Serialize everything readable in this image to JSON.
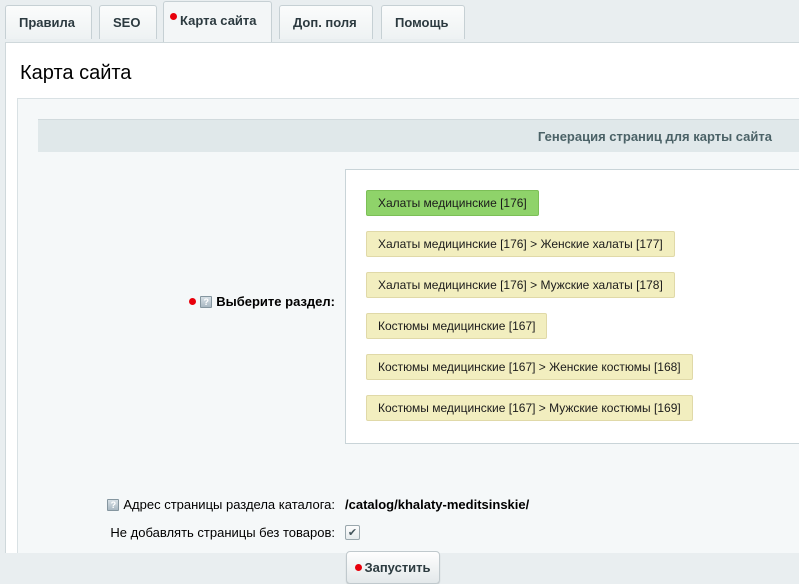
{
  "tabs": [
    {
      "label": "Правила",
      "active": false
    },
    {
      "label": "SEO",
      "active": false
    },
    {
      "label": "Карта сайта",
      "active": true
    },
    {
      "label": "Доп. поля",
      "active": false
    },
    {
      "label": "Помощь",
      "active": false
    }
  ],
  "page_title": "Карта сайта",
  "section_header": "Генерация страниц для карты сайта",
  "section_select": {
    "label": "Выберите раздел:",
    "required": true,
    "items": [
      {
        "label": "Халаты медицинские [176]",
        "selected": true
      },
      {
        "label": "Халаты медицинские [176] > Женские халаты [177]",
        "selected": false
      },
      {
        "label": "Халаты медицинские [176] > Мужские халаты [178]",
        "selected": false
      },
      {
        "label": "Костюмы медицинские [167]",
        "selected": false
      },
      {
        "label": "Костюмы медицинские [167] > Женские костюмы [168]",
        "selected": false
      },
      {
        "label": "Костюмы медицинские [167] > Мужские костюмы [169]",
        "selected": false
      }
    ]
  },
  "catalog_address": {
    "label": "Адрес страницы раздела каталога:",
    "value": "/catalog/khalaty-meditsinskie/"
  },
  "no_empty_pages": {
    "label": "Не добавлять страницы без товаров:",
    "checked": true
  },
  "run_button": {
    "label": "Запустить"
  },
  "colors": {
    "required_dot": "#e8000b",
    "selected_chip": "#8fd36a",
    "chip": "#f2eebf",
    "section_header_bg": "#e0e8ea"
  },
  "icons": {
    "help": "help-icon",
    "check": "checkmark-icon"
  }
}
